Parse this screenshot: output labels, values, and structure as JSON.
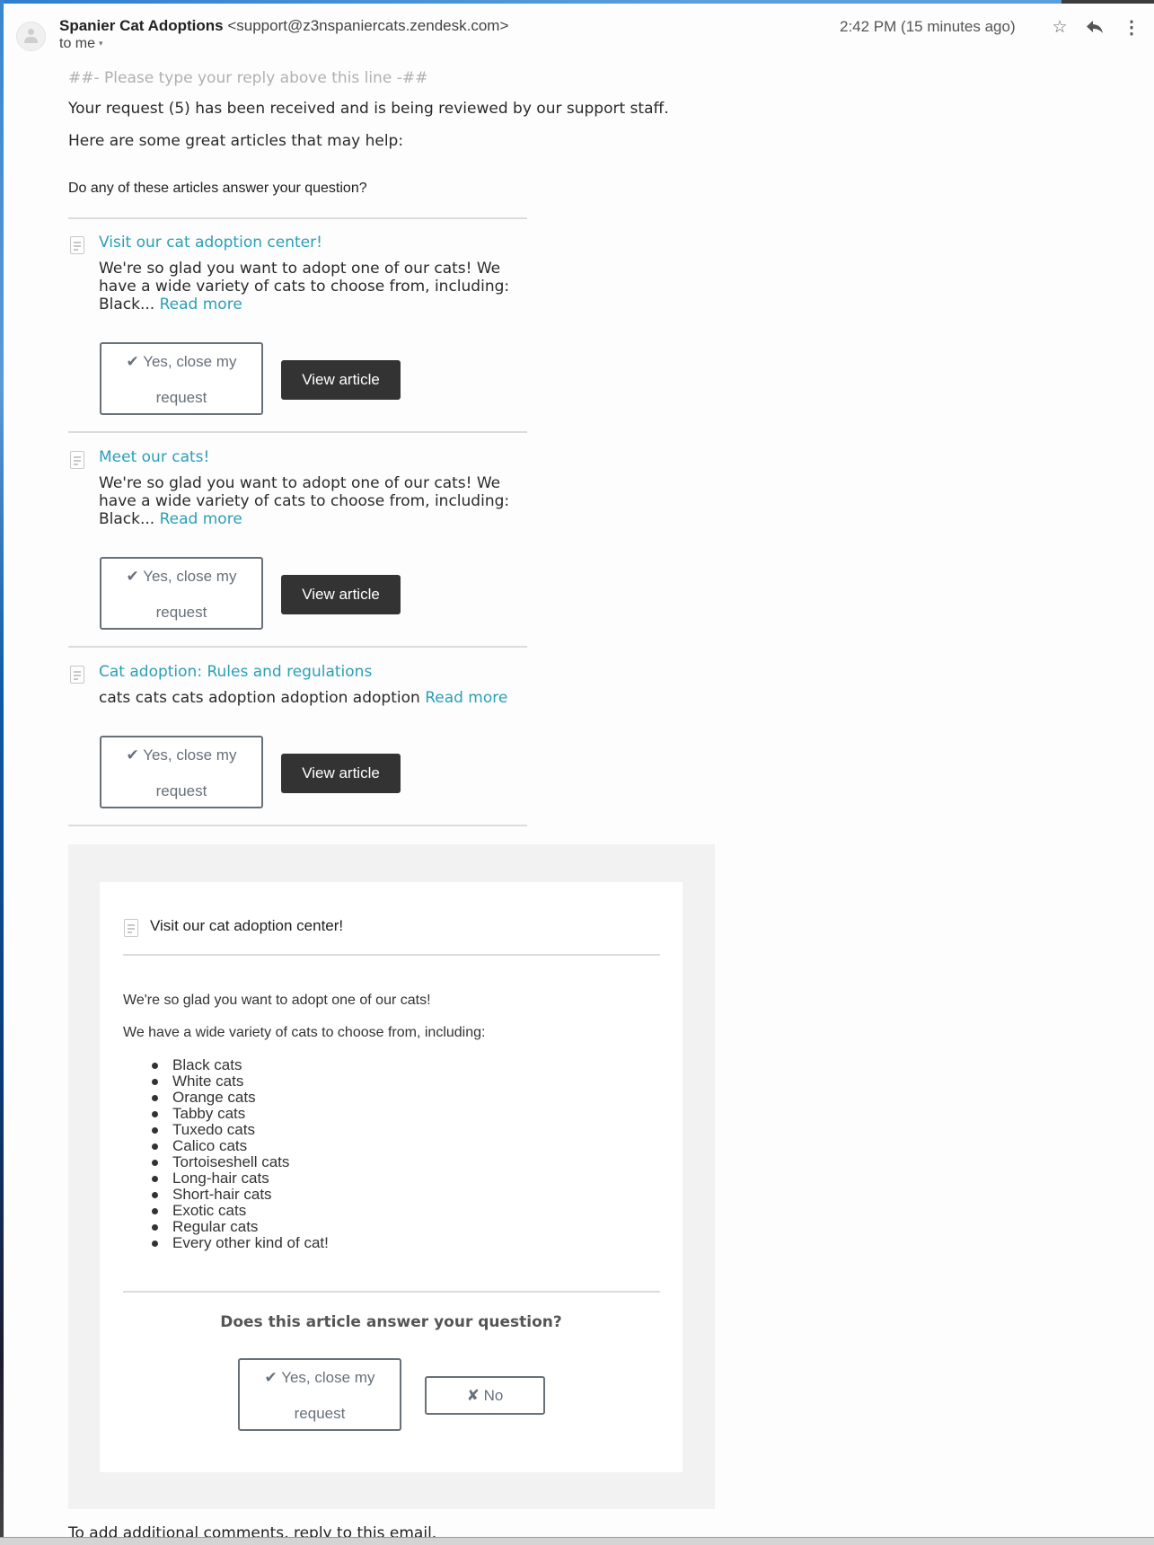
{
  "header": {
    "sender_name": "Spanier Cat Adoptions",
    "sender_email": "<support@z3nspaniercats.zendesk.com>",
    "recipient": "to me",
    "timestamp": "2:42 PM (15 minutes ago)",
    "icons": {
      "star": "☆",
      "reply": "reply-arrow",
      "more": "⋮",
      "caret": "▾"
    }
  },
  "body": {
    "reply_line": "##- Please type your reply above this line -##",
    "received_line": "Your request (5) has been received and is being reviewed by our support staff.",
    "help_line": "Here are some great articles that may help:",
    "question_line": "Do any of these articles answer your question?"
  },
  "articles": [
    {
      "title": "Visit our cat adoption center!",
      "snippet": "We're so glad you want to adopt one of our cats!  We have a wide variety of cats to choose from, including: Black...",
      "read_more": "Read more",
      "yes_label_line1": "✔ Yes, close my",
      "yes_label_line2": "request",
      "view_label": "View article"
    },
    {
      "title": "Meet our cats!",
      "snippet": "We're so glad you want to adopt one of our cats!  We have a wide variety of cats to choose from, including: Black...",
      "read_more": "Read more",
      "yes_label_line1": "✔ Yes, close my",
      "yes_label_line2": "request",
      "view_label": "View article"
    },
    {
      "title": "Cat adoption: Rules and regulations",
      "snippet": "cats cats cats adoption adoption adoption",
      "read_more": "Read more",
      "yes_label_line1": "✔ Yes, close my",
      "yes_label_line2": "request",
      "view_label": "View article"
    }
  ],
  "featured": {
    "title": "Visit our cat adoption center!",
    "intro": "We're so glad you want to adopt one of our cats!",
    "variety": "We have a wide variety of cats to choose from, including:",
    "cats": [
      "Black cats",
      "White cats",
      "Orange cats",
      "Tabby cats",
      "Tuxedo cats",
      "Calico cats",
      "Tortoiseshell cats",
      "Long-hair cats",
      "Short-hair cats",
      "Exotic cats",
      "Regular cats",
      "Every other kind of cat!"
    ],
    "question": "Does this article answer your question?",
    "yes_label_line1": "✔ Yes, close my",
    "yes_label_line2": "request",
    "no_label": "✘ No"
  },
  "footer": {
    "text": "To add additional comments, reply to this email."
  },
  "colors": {
    "link": "#2a9fb6",
    "dark_button": "#333333",
    "outline_button": "#68707a"
  }
}
